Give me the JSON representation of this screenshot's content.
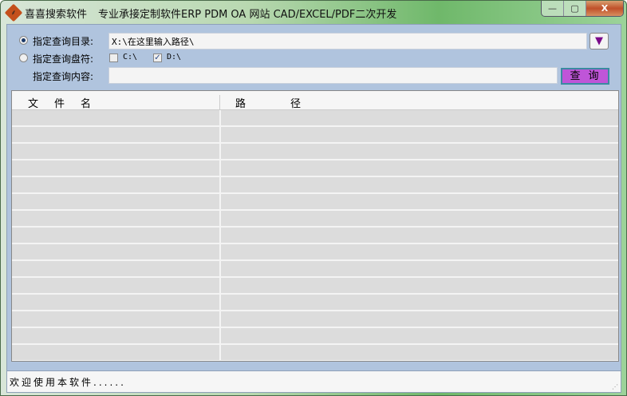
{
  "window": {
    "app_name": "喜喜搜索软件",
    "subtitle": "专业承接定制软件ERP PDM OA 网站 CAD/EXCEL/PDF二次开发",
    "logo_glyph": "☸",
    "minimize": "—",
    "maximize": "▢",
    "close": "X"
  },
  "form": {
    "dir_label": "指定查询目录:",
    "dir_value": "X:\\在这里输入路径\\",
    "drive_label": "指定查询盘符:",
    "drives": [
      {
        "label": "C:\\",
        "checked": false
      },
      {
        "label": "D:\\",
        "checked": true
      }
    ],
    "content_label": "指定查询内容:",
    "content_value": "",
    "dropdown_icon": "▼",
    "query_button": "查询"
  },
  "table": {
    "columns": [
      "文件名",
      "路径"
    ],
    "rows": 16
  },
  "status": {
    "text": "欢迎使用本软件......",
    "grip": "⋰"
  }
}
